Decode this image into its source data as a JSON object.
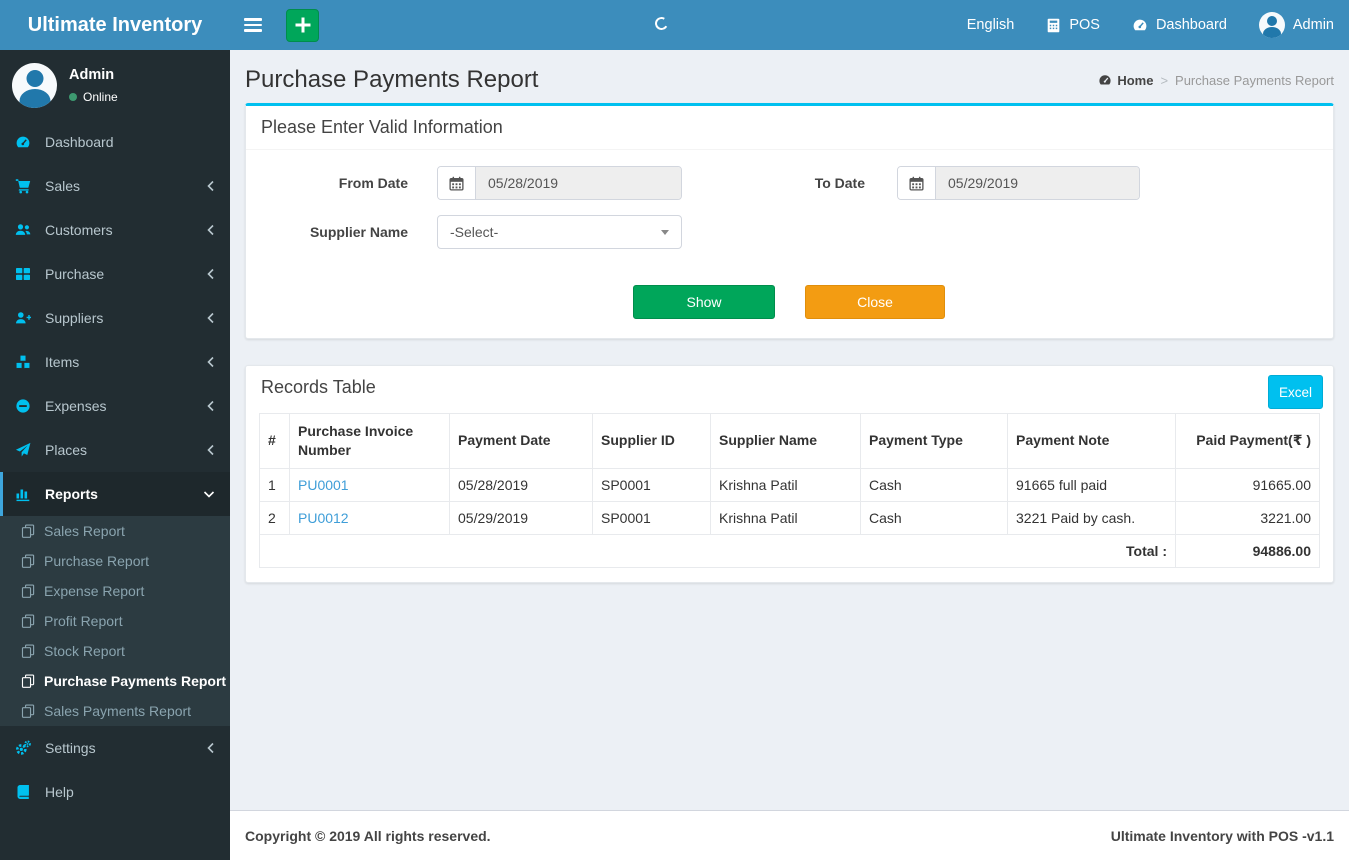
{
  "app": {
    "title": "Ultimate Inventory",
    "footer_left": "Copyright © 2019 All rights reserved.",
    "footer_right": "Ultimate Inventory with POS -v1.1"
  },
  "navbar": {
    "language": "English",
    "pos_label": "POS",
    "dashboard_label": "Dashboard",
    "user_label": "Admin"
  },
  "sidebar": {
    "user_name": "Admin",
    "user_status": "Online",
    "items": [
      {
        "label": "Dashboard",
        "icon": "tachometer-icon",
        "has_chevron": false
      },
      {
        "label": "Sales",
        "icon": "cart-icon",
        "has_chevron": true
      },
      {
        "label": "Customers",
        "icon": "users-icon",
        "has_chevron": true
      },
      {
        "label": "Purchase",
        "icon": "grid-icon",
        "has_chevron": true
      },
      {
        "label": "Suppliers",
        "icon": "user-plus-icon",
        "has_chevron": true
      },
      {
        "label": "Items",
        "icon": "cubes-icon",
        "has_chevron": true
      },
      {
        "label": "Expenses",
        "icon": "minus-circle-icon",
        "has_chevron": true
      },
      {
        "label": "Places",
        "icon": "paper-plane-icon",
        "has_chevron": true
      },
      {
        "label": "Reports",
        "icon": "bar-chart-icon",
        "has_chevron": true,
        "expanded": true,
        "active": true
      },
      {
        "label": "Settings",
        "icon": "gears-icon",
        "has_chevron": true
      },
      {
        "label": "Help",
        "icon": "book-icon",
        "has_chevron": false
      }
    ],
    "reports_submenu": [
      {
        "label": "Sales Report",
        "active": false
      },
      {
        "label": "Purchase Report",
        "active": false
      },
      {
        "label": "Expense Report",
        "active": false
      },
      {
        "label": "Profit Report",
        "active": false
      },
      {
        "label": "Stock Report",
        "active": false
      },
      {
        "label": "Purchase Payments Report",
        "active": true
      },
      {
        "label": "Sales Payments Report",
        "active": false
      }
    ]
  },
  "page": {
    "title": "Purchase Payments Report",
    "breadcrumb": {
      "home": "Home",
      "separator": ">",
      "current": "Purchase Payments Report"
    }
  },
  "filter": {
    "box_title": "Please Enter Valid Information",
    "from_date": {
      "label": "From Date",
      "value": "05/28/2019"
    },
    "to_date": {
      "label": "To Date",
      "value": "05/29/2019"
    },
    "supplier": {
      "label": "Supplier Name",
      "selected": "-Select-"
    },
    "show_label": "Show",
    "close_label": "Close"
  },
  "records": {
    "box_title": "Records Table",
    "excel_label": "Excel",
    "columns": [
      "#",
      "Purchase Invoice Number",
      "Payment Date",
      "Supplier ID",
      "Supplier Name",
      "Payment Type",
      "Payment Note",
      "Paid Payment(₹ )"
    ],
    "rows": [
      [
        "1",
        "PU0001",
        "05/28/2019",
        "SP0001",
        "Krishna Patil",
        "Cash",
        "91665 full paid",
        "91665.00"
      ],
      [
        "2",
        "PU0012",
        "05/29/2019",
        "SP0001",
        "Krishna Patil",
        "Cash",
        "3221 Paid by cash.",
        "3221.00"
      ]
    ],
    "total_label": "Total :",
    "total_value": "94886.00"
  },
  "colors": {
    "header_blue": "#3c8dbc",
    "sidebar_dark": "#222d32",
    "submenu_dark": "#2c3b41",
    "icon_cyan": "#00c0ef",
    "active_border_blue": "#3ea6dd",
    "success_green": "#00a65a",
    "warning_orange": "#f39c12",
    "excel_cyan": "#00c0ef",
    "link_blue": "#3f9ed8",
    "online_green": "#3d9970",
    "content_bg": "#ecf0f5"
  }
}
